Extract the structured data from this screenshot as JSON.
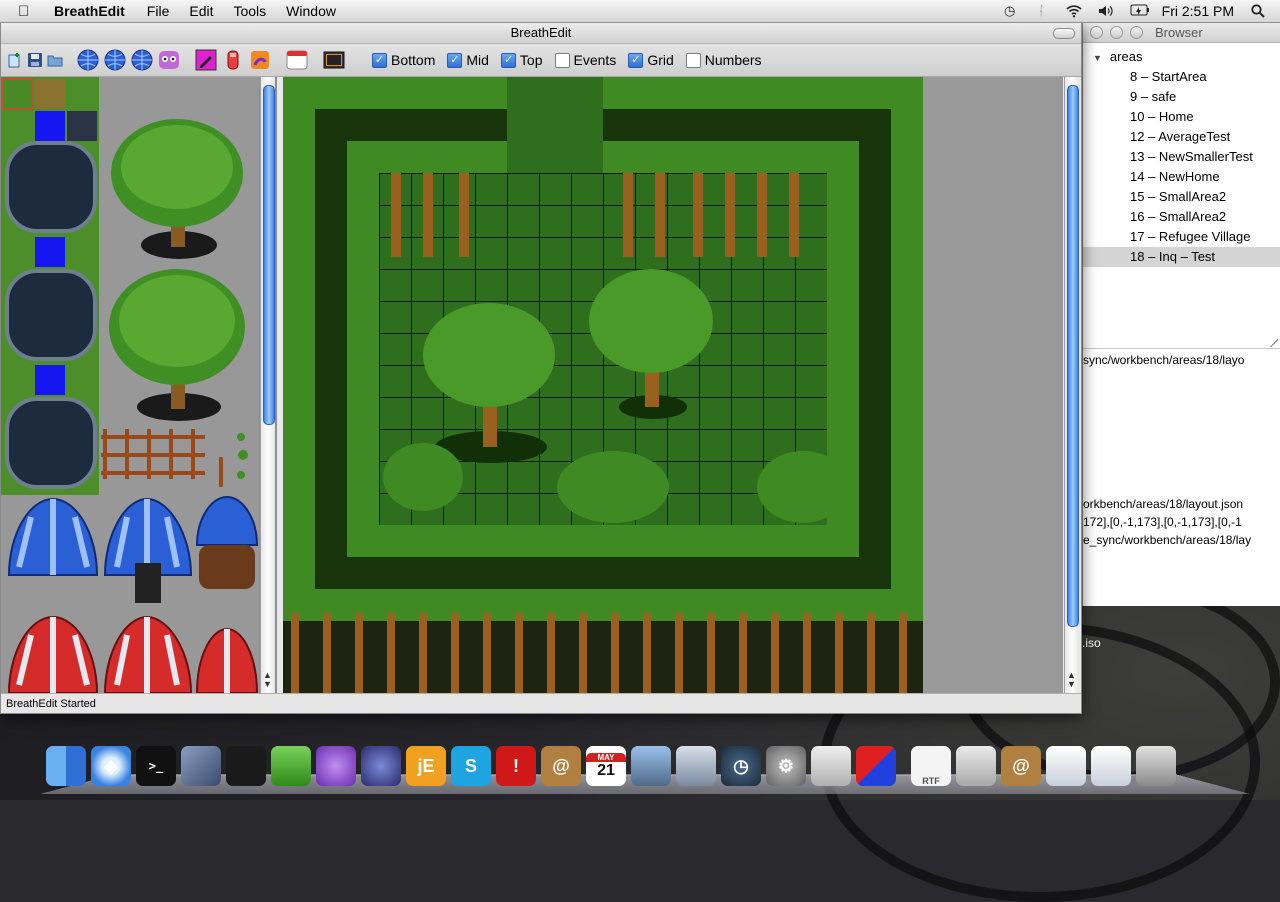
{
  "menubar": {
    "app_name": "BreathEdit",
    "menus": [
      "File",
      "Edit",
      "Tools",
      "Window"
    ],
    "clock": "Fri 2:51 PM"
  },
  "main_window": {
    "title": "BreathEdit",
    "layers": [
      {
        "label": "Bottom",
        "checked": true
      },
      {
        "label": "Mid",
        "checked": true
      },
      {
        "label": "Top",
        "checked": true
      },
      {
        "label": "Events",
        "checked": false
      },
      {
        "label": "Grid",
        "checked": true
      },
      {
        "label": "Numbers",
        "checked": false
      }
    ],
    "status": "BreathEdit Started"
  },
  "browser": {
    "title": "Browser",
    "root": "areas",
    "areas": [
      "8 – StartArea",
      "9 – safe",
      "10 – Home",
      "12 – AverageTest",
      "13 – NewSmallerTest",
      "14 – NewHome",
      "15 – SmallArea2",
      "16 – SmallArea2",
      "17 – Refugee Village",
      "18 – Inq – Test"
    ],
    "selected_index": 9,
    "log_lines": [
      "sync/workbench/areas/18/layo",
      "orkbench/areas/18/layout.json",
      "172],[0,-1,173],[0,-1,173],[0,-1",
      "e_sync/workbench/areas/18/lay"
    ]
  },
  "desktop_label": ".iso",
  "dock": {
    "items": [
      "finder",
      "safari",
      "terminal",
      "vmware",
      "activity-monitor",
      "transmit",
      "colloquy",
      "eclipse",
      "jedit",
      "skype",
      "textmate",
      "address-book",
      "ical",
      "iphoto",
      "preview",
      "time-machine",
      "system-preferences",
      "script-editor",
      "quicksilver",
      "rtf-document",
      "bundle",
      "address-book-2",
      "window-list",
      "downloads",
      "trash"
    ],
    "ical_month": "MAY",
    "ical_day": "21",
    "rtf_label": "RTF"
  },
  "colors": {
    "selection": "#2f6fd6",
    "grass": "#2f6e1c",
    "grid": "#0b1a06"
  }
}
